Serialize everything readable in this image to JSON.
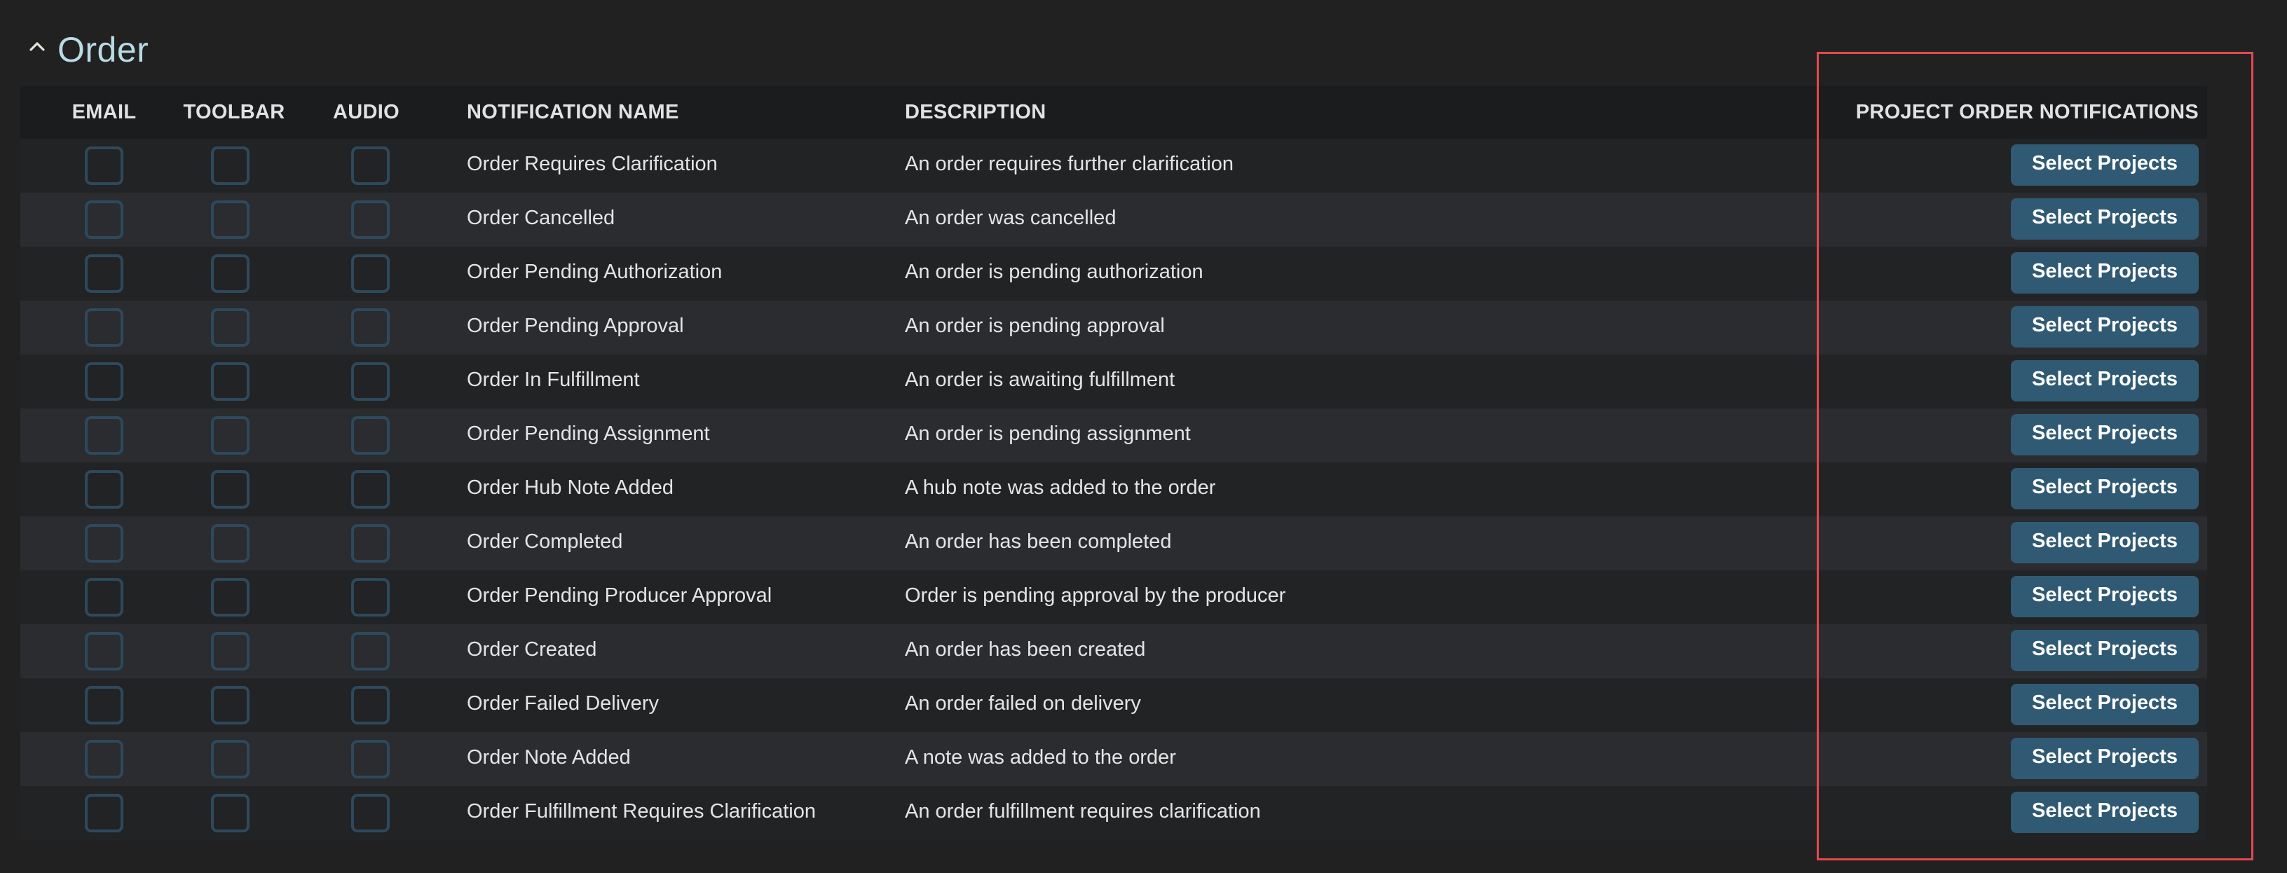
{
  "section": {
    "title": "Order",
    "toggle_icon": "chevron-up-icon",
    "expanded": true
  },
  "table": {
    "headers": {
      "email": "EMAIL",
      "toolbar": "TOOLBAR",
      "audio": "AUDIO",
      "name": "NOTIFICATION NAME",
      "description": "DESCRIPTION",
      "project": "PROJECT ORDER NOTIFICATIONS"
    },
    "rows": [
      {
        "name": "Order Requires Clarification",
        "description": "An order requires further clarification",
        "email": false,
        "toolbar": false,
        "audio": false,
        "button": "Select Projects"
      },
      {
        "name": "Order Cancelled",
        "description": "An order was cancelled",
        "email": false,
        "toolbar": false,
        "audio": false,
        "button": "Select Projects"
      },
      {
        "name": "Order Pending Authorization",
        "description": "An order is pending authorization",
        "email": false,
        "toolbar": false,
        "audio": false,
        "button": "Select Projects"
      },
      {
        "name": "Order Pending Approval",
        "description": "An order is pending approval",
        "email": false,
        "toolbar": false,
        "audio": false,
        "button": "Select Projects"
      },
      {
        "name": "Order In Fulfillment",
        "description": "An order is awaiting fulfillment",
        "email": false,
        "toolbar": false,
        "audio": false,
        "button": "Select Projects"
      },
      {
        "name": "Order Pending Assignment",
        "description": "An order is pending assignment",
        "email": false,
        "toolbar": false,
        "audio": false,
        "button": "Select Projects"
      },
      {
        "name": "Order Hub Note Added",
        "description": "A hub note was added to the order",
        "email": false,
        "toolbar": false,
        "audio": false,
        "button": "Select Projects"
      },
      {
        "name": "Order Completed",
        "description": "An order has been completed",
        "email": false,
        "toolbar": false,
        "audio": false,
        "button": "Select Projects"
      },
      {
        "name": "Order Pending Producer Approval",
        "description": "Order is pending approval by the producer",
        "email": false,
        "toolbar": false,
        "audio": false,
        "button": "Select Projects"
      },
      {
        "name": "Order Created",
        "description": "An order has been created",
        "email": false,
        "toolbar": false,
        "audio": false,
        "button": "Select Projects"
      },
      {
        "name": "Order Failed Delivery",
        "description": "An order failed on delivery",
        "email": false,
        "toolbar": false,
        "audio": false,
        "button": "Select Projects"
      },
      {
        "name": "Order Note Added",
        "description": "A note was added to the order",
        "email": false,
        "toolbar": false,
        "audio": false,
        "button": "Select Projects"
      },
      {
        "name": "Order Fulfillment Requires Clarification",
        "description": "An order fulfillment requires clarification",
        "email": false,
        "toolbar": false,
        "audio": false,
        "button": "Select Projects"
      }
    ]
  },
  "colors": {
    "page_background": "#212121",
    "header_background": "#1a1c1d",
    "row_odd": "#222325",
    "row_even": "#2a2c30",
    "title": "#b9dbe3",
    "checkbox_border": "#2e495c",
    "button_background": "#305a74",
    "highlight_outline": "#e5484d"
  },
  "highlight": {
    "target": "project-order-notifications-column"
  }
}
